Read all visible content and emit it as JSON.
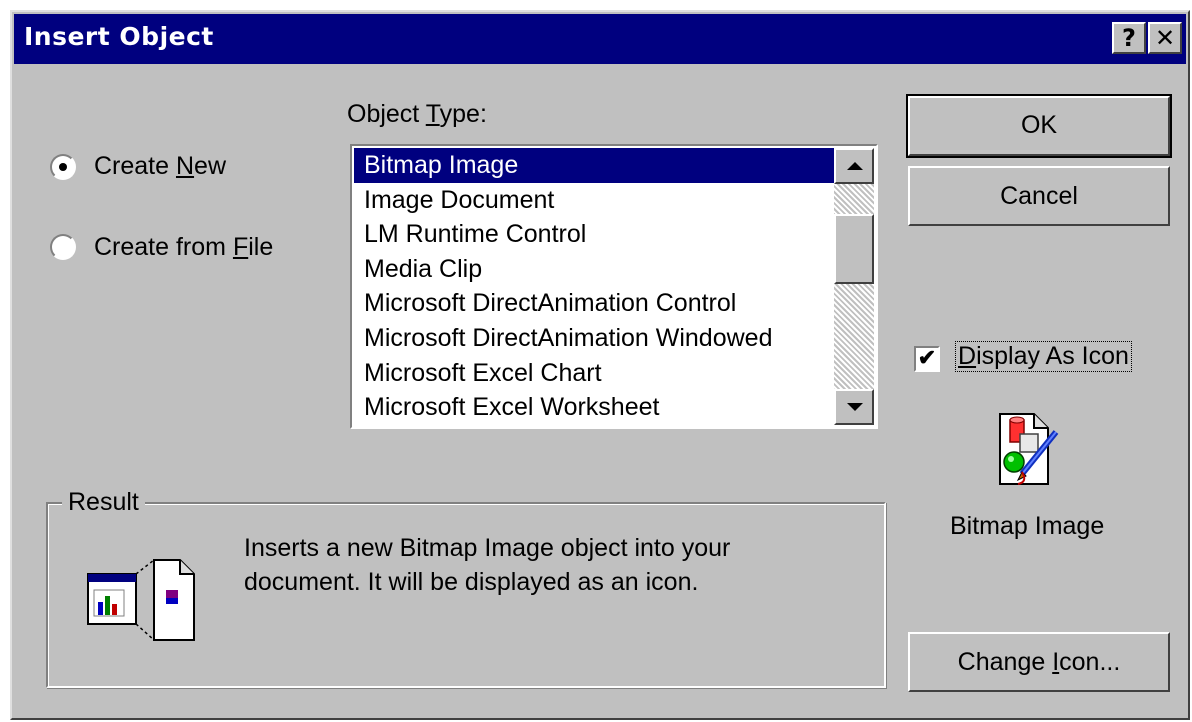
{
  "window": {
    "title": "Insert Object",
    "help_glyph": "?",
    "close_glyph": "✕"
  },
  "options": {
    "create_new": {
      "prefix": "Create ",
      "accel": "N",
      "suffix": "ew",
      "selected": true
    },
    "create_from_file": {
      "prefix": "Create from ",
      "accel": "F",
      "suffix": "ile",
      "selected": false
    }
  },
  "object_type": {
    "label_prefix": "Object ",
    "label_accel": "T",
    "label_suffix": "ype:",
    "items": [
      "Bitmap Image",
      "Image Document",
      "LM Runtime Control",
      "Media Clip",
      "Microsoft DirectAnimation Control",
      "Microsoft DirectAnimation Windowed",
      "Microsoft Excel Chart",
      "Microsoft Excel Worksheet"
    ],
    "selected_index": 0
  },
  "buttons": {
    "ok": "OK",
    "cancel": "Cancel",
    "change_icon_prefix": "Change ",
    "change_icon_accel": "I",
    "change_icon_suffix": "con..."
  },
  "display_as_icon": {
    "accel": "D",
    "suffix": "isplay As Icon",
    "checked": true,
    "check_glyph": "✔"
  },
  "icon_preview": {
    "icon": "bitmap-image-paint-icon",
    "caption": "Bitmap Image"
  },
  "result": {
    "title": "Result",
    "icon": "insert-object-result-icon",
    "line1": "Inserts a new Bitmap Image object into your",
    "line2": "document.  It will be displayed as an icon."
  },
  "colors": {
    "dialog_face": "#c0c0c0",
    "title_bar": "#00007f",
    "selection": "#00007f"
  }
}
